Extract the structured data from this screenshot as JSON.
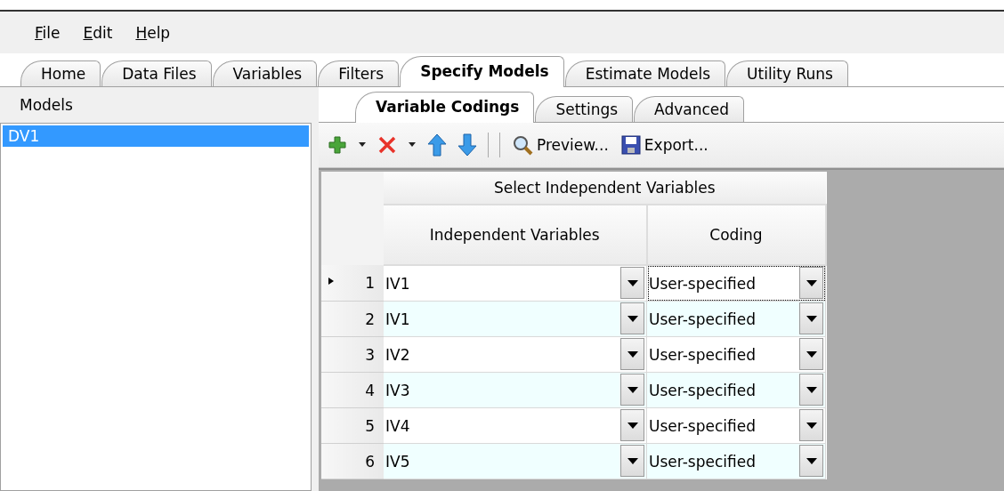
{
  "menu": [
    {
      "label": "File"
    },
    {
      "label": "Edit"
    },
    {
      "label": "Help"
    }
  ],
  "tabs": [
    {
      "label": "Home",
      "selected": false
    },
    {
      "label": "Data Files",
      "selected": false
    },
    {
      "label": "Variables",
      "selected": false
    },
    {
      "label": "Filters",
      "selected": false
    },
    {
      "label": "Specify Models",
      "selected": true
    },
    {
      "label": "Estimate Models",
      "selected": false
    },
    {
      "label": "Utility Runs",
      "selected": false
    }
  ],
  "models": {
    "header": "Models",
    "items": [
      {
        "label": "DV1",
        "selected": true
      }
    ]
  },
  "subtabs": [
    {
      "label": "Variable Codings",
      "selected": true
    },
    {
      "label": "Settings",
      "selected": false
    },
    {
      "label": "Advanced",
      "selected": false
    }
  ],
  "toolbar": {
    "buttons": [
      {
        "label": "Preview..."
      },
      {
        "label": "Export..."
      }
    ]
  },
  "grid": {
    "band": "Select Independent Variables",
    "columns": [
      "Independent Variables",
      "Coding"
    ],
    "rows": [
      {
        "number": "1",
        "current": true,
        "variable": "IV1",
        "coding": "User-specified",
        "focused": true
      },
      {
        "number": "2",
        "current": false,
        "variable": "IV1",
        "coding": "User-specified",
        "focused": false
      },
      {
        "number": "3",
        "current": false,
        "variable": "IV2",
        "coding": "User-specified",
        "focused": false
      },
      {
        "number": "4",
        "current": false,
        "variable": "IV3",
        "coding": "User-specified",
        "focused": false
      },
      {
        "number": "5",
        "current": false,
        "variable": "IV4",
        "coding": "User-specified",
        "focused": false
      },
      {
        "number": "6",
        "current": false,
        "variable": "IV5",
        "coding": "User-specified",
        "focused": false
      }
    ]
  }
}
